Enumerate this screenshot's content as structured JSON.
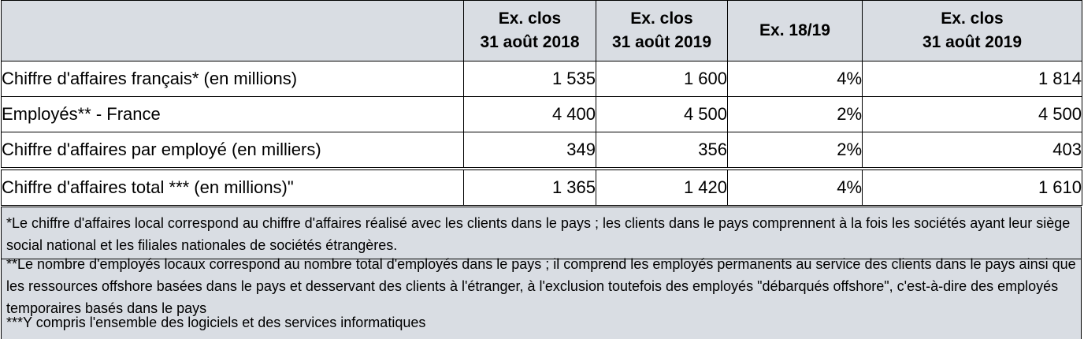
{
  "table": {
    "headers": [
      "",
      "Ex. clos\n31 août 2018",
      "Ex. clos\n31 août 2019",
      "Ex. 18/19",
      "Ex. clos\n31 août 2019"
    ],
    "header_lines": {
      "c1": [
        "Ex. clos",
        "31 août 2018"
      ],
      "c2": [
        "Ex. clos",
        "31 août 2019"
      ],
      "c3": [
        "Ex. 18/19"
      ],
      "c4": [
        "Ex. clos",
        "31 août 2019"
      ]
    },
    "rows": [
      {
        "label": "Chiffre d'affaires français* (en millions)",
        "c1": "1 535",
        "c2": "1 600",
        "c3": "4%",
        "c4": "1 814"
      },
      {
        "label": "Employés** - France",
        "c1": "4 400",
        "c2": "4 500",
        "c3": "2%",
        "c4": "4 500"
      },
      {
        "label": "Chiffre d'affaires par employé (en milliers)",
        "c1": "349",
        "c2": "356",
        "c3": "2%",
        "c4": "403"
      },
      {
        "label": "Chiffre d'affaires total *** (en millions)\"",
        "c1": "1 365",
        "c2": "1 420",
        "c3": "4%",
        "c4": "1 610"
      }
    ]
  },
  "notes": {
    "n1": "*Le chiffre d'affaires local correspond au chiffre d'affaires réalisé avec les clients dans le pays ; les clients dans le pays comprennent à la fois les sociétés ayant leur siège social national et les filiales nationales de sociétés étrangères.",
    "n2": "**Le nombre d'employés locaux correspond au nombre total d'employés dans le pays ; il comprend les employés permanents au service des clients dans le pays ainsi que les ressources offshore basées dans le pays et desservant des clients à l'étranger, à l'exclusion toutefois des employés \"débarqués offshore\", c'est-à-dire des employés temporaires basés dans le pays",
    "n3": "***Y compris l'ensemble des logiciels et des services informatiques"
  },
  "colors": {
    "header_bg": "#d9dde3",
    "notes_bg": "#d9dde3",
    "border": "#000000"
  }
}
